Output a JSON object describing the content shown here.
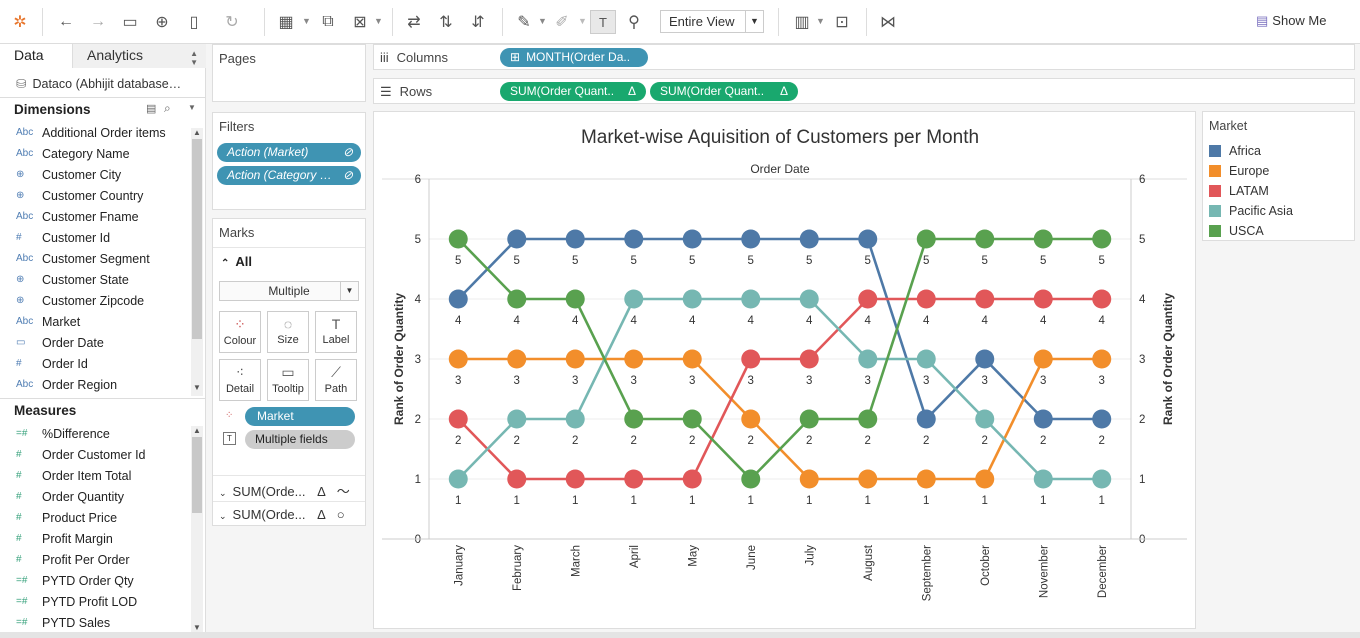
{
  "toolbar": {
    "view_select": "Entire View",
    "show_me": "Show Me"
  },
  "left": {
    "tab_data": "Data",
    "tab_analytics": "Analytics",
    "datasource": "Dataco (Abhijit database…",
    "dimensions_title": "Dimensions",
    "dimensions": [
      {
        "type": "Abc",
        "name": "Additional Order items"
      },
      {
        "type": "Abc",
        "name": "Category Name"
      },
      {
        "type": "geo",
        "name": "Customer City"
      },
      {
        "type": "geo",
        "name": "Customer Country"
      },
      {
        "type": "Abc",
        "name": "Customer Fname"
      },
      {
        "type": "#",
        "name": "Customer Id"
      },
      {
        "type": "Abc",
        "name": "Customer Segment"
      },
      {
        "type": "geo",
        "name": "Customer State"
      },
      {
        "type": "geo",
        "name": "Customer Zipcode"
      },
      {
        "type": "Abc",
        "name": "Market"
      },
      {
        "type": "date",
        "name": "Order Date"
      },
      {
        "type": "#",
        "name": "Order Id"
      },
      {
        "type": "Abc",
        "name": "Order Region"
      }
    ],
    "measures_title": "Measures",
    "measures": [
      {
        "type": "=#",
        "name": "%Difference"
      },
      {
        "type": "#",
        "name": "Order Customer Id"
      },
      {
        "type": "#",
        "name": "Order Item Total"
      },
      {
        "type": "#",
        "name": "Order Quantity"
      },
      {
        "type": "#",
        "name": "Product Price"
      },
      {
        "type": "#",
        "name": "Profit Margin"
      },
      {
        "type": "#",
        "name": "Profit Per Order"
      },
      {
        "type": "=#",
        "name": "PYTD Order Qty"
      },
      {
        "type": "=#",
        "name": "PYTD Profit LOD"
      },
      {
        "type": "=#",
        "name": "PYTD Sales"
      }
    ]
  },
  "pages": {
    "title": "Pages"
  },
  "filters": {
    "title": "Filters",
    "items": [
      "Action (Market)",
      "Action (Category …"
    ]
  },
  "marks": {
    "title": "Marks",
    "all_label": "All",
    "mark_type": "Multiple",
    "buttons": [
      "Colour",
      "Size",
      "Label",
      "Detail",
      "Tooltip",
      "Path"
    ],
    "market_pill": "Market",
    "fields_pill": "Multiple fields",
    "sum1": "SUM(Orde...",
    "sum2": "SUM(Orde..."
  },
  "shelves": {
    "columns_label": "Columns",
    "rows_label": "Rows",
    "columns_pill": "MONTH(Order Da..",
    "rows_pill1": "SUM(Order Quant..",
    "rows_pill2": "SUM(Order Quant..",
    "delta": "Δ"
  },
  "legend": {
    "title": "Market",
    "items": [
      {
        "name": "Africa",
        "color": "#4e79a7"
      },
      {
        "name": "Europe",
        "color": "#f28e2b"
      },
      {
        "name": "LATAM",
        "color": "#e15759"
      },
      {
        "name": "Pacific Asia",
        "color": "#76b7b2"
      },
      {
        "name": "USCA",
        "color": "#59a14f"
      }
    ]
  },
  "chart_data": {
    "type": "line",
    "title": "Market-wise Aquisition of Customers per Month",
    "xlabel": "Order Date",
    "ylabel": "Rank of Order Quantity",
    "ylabel_right": "Rank of Order Quantity",
    "ylim": [
      0,
      6
    ],
    "yticks": [
      0,
      1,
      2,
      3,
      4,
      5,
      6
    ],
    "categories": [
      "January",
      "February",
      "March",
      "April",
      "May",
      "June",
      "July",
      "August",
      "September",
      "October",
      "November",
      "December"
    ],
    "series": [
      {
        "name": "Africa",
        "color": "#4e79a7",
        "values": [
          4,
          5,
          5,
          5,
          5,
          5,
          5,
          5,
          2,
          3,
          2,
          2
        ]
      },
      {
        "name": "Europe",
        "color": "#f28e2b",
        "values": [
          3,
          3,
          3,
          3,
          3,
          2,
          1,
          1,
          1,
          1,
          3,
          3
        ]
      },
      {
        "name": "LATAM",
        "color": "#e15759",
        "values": [
          2,
          1,
          1,
          1,
          1,
          3,
          3,
          4,
          4,
          4,
          4,
          4
        ]
      },
      {
        "name": "Pacific Asia",
        "color": "#76b7b2",
        "values": [
          1,
          2,
          2,
          4,
          4,
          4,
          4,
          3,
          3,
          2,
          1,
          1
        ]
      },
      {
        "name": "USCA",
        "color": "#59a14f",
        "values": [
          5,
          4,
          4,
          2,
          2,
          1,
          2,
          2,
          5,
          5,
          5,
          5
        ]
      }
    ]
  }
}
